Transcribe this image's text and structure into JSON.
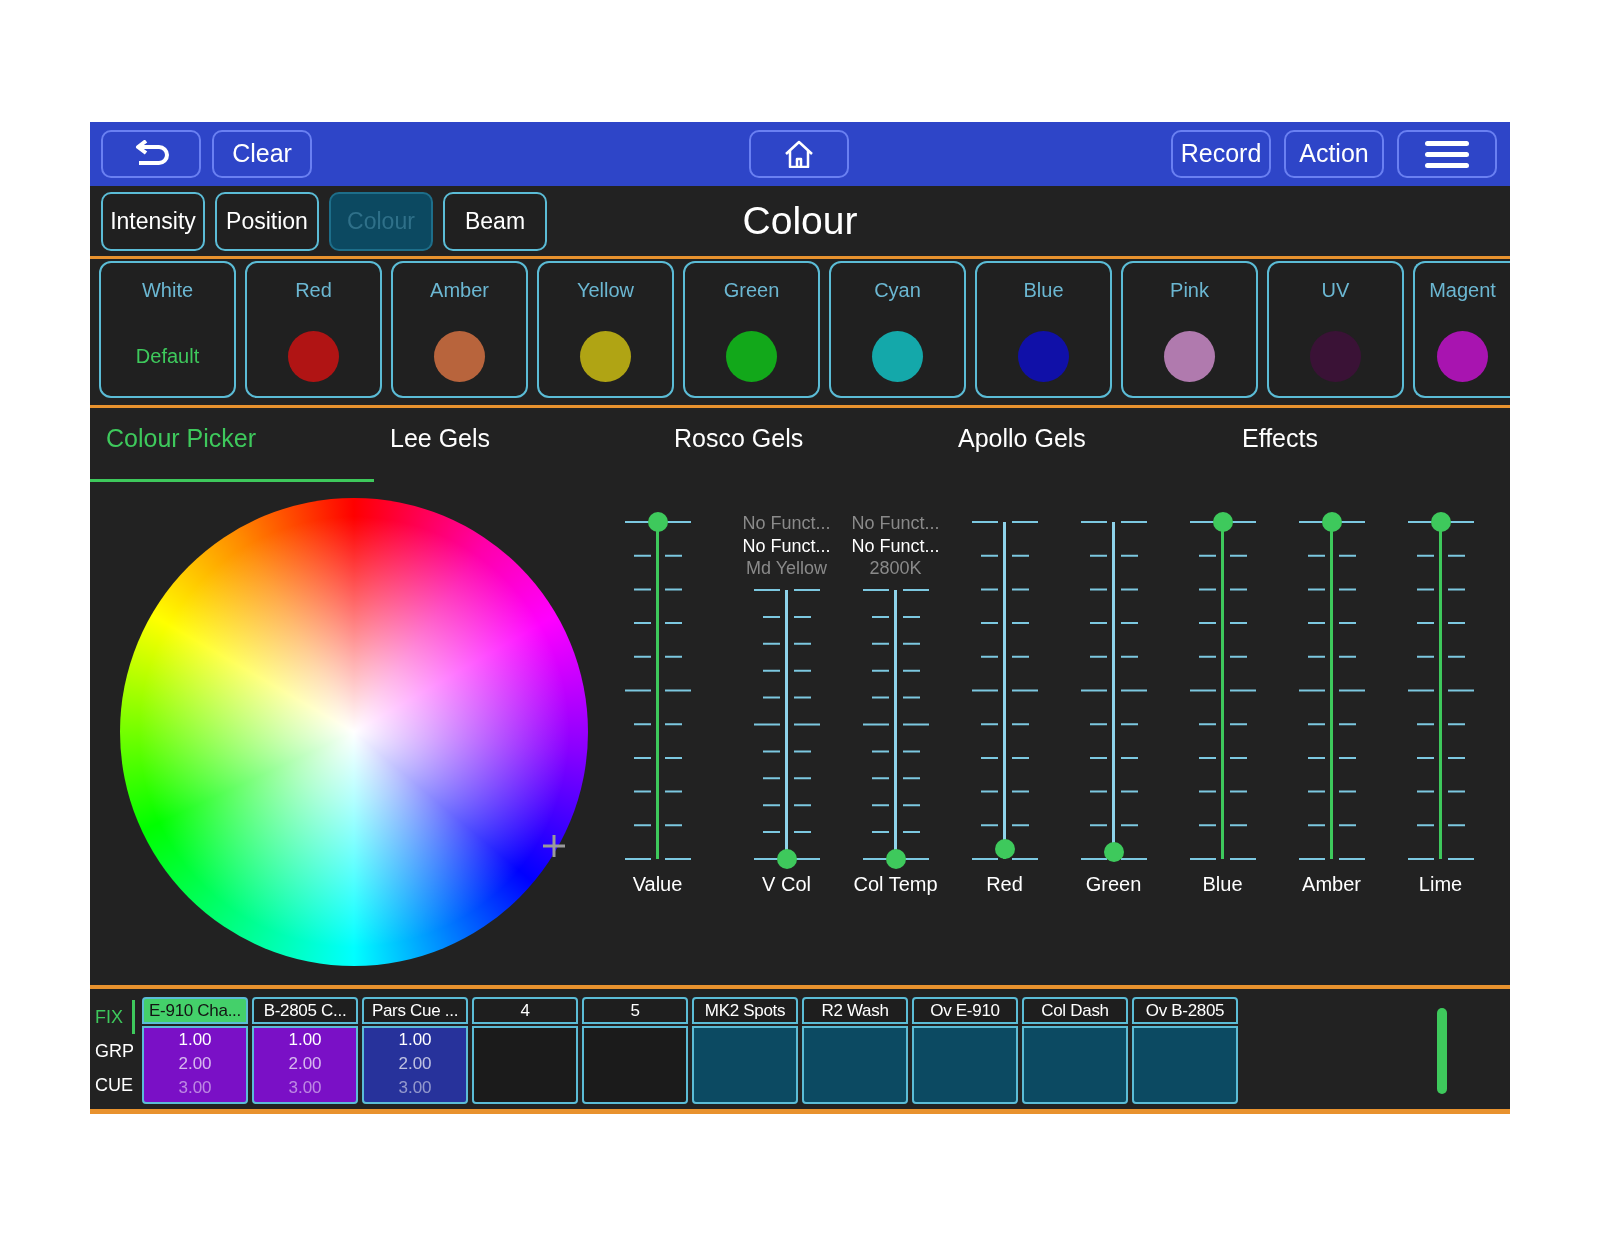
{
  "toolbar": {
    "left": [
      {
        "kind": "back"
      },
      {
        "kind": "text",
        "label": "Clear"
      }
    ],
    "center": [
      {
        "kind": "home"
      }
    ],
    "right": [
      {
        "kind": "text",
        "label": "Record"
      },
      {
        "kind": "text",
        "label": "Action"
      },
      {
        "kind": "menu"
      }
    ]
  },
  "attribute_tabs": [
    {
      "label": "Intensity",
      "selected": false
    },
    {
      "label": "Position",
      "selected": false
    },
    {
      "label": "Colour",
      "selected": true
    },
    {
      "label": "Beam",
      "selected": false
    }
  ],
  "title": "Colour",
  "swatches": [
    {
      "label": "White",
      "kind": "text",
      "text": "Default"
    },
    {
      "label": "Red",
      "kind": "dot",
      "color": "#b01414"
    },
    {
      "label": "Amber",
      "kind": "dot",
      "color": "#b8643c"
    },
    {
      "label": "Yellow",
      "kind": "dot",
      "color": "#b0a414"
    },
    {
      "label": "Green",
      "kind": "dot",
      "color": "#12a81a"
    },
    {
      "label": "Cyan",
      "kind": "dot",
      "color": "#14a8aa"
    },
    {
      "label": "Blue",
      "kind": "dot",
      "color": "#1010a8"
    },
    {
      "label": "Pink",
      "kind": "dot",
      "color": "#b07aae"
    },
    {
      "label": "UV",
      "kind": "dot",
      "color": "#3a1236"
    },
    {
      "label": "Magent",
      "kind": "dot",
      "color": "#a814b0"
    }
  ],
  "sub_tabs": [
    {
      "label": "Colour Picker",
      "selected": true
    },
    {
      "label": "Lee Gels",
      "selected": false
    },
    {
      "label": "Rosco Gels",
      "selected": false
    },
    {
      "label": "Apollo Gels",
      "selected": false
    },
    {
      "label": "Effects",
      "selected": false
    }
  ],
  "faders": [
    {
      "label": "Value",
      "level": 1
    },
    {
      "label": "V Col",
      "level": 0,
      "info": [
        {
          "text": "No Funct...",
          "selected": false
        },
        {
          "text": "No Funct...",
          "selected": true
        },
        {
          "text": "Md Yellow",
          "selected": false
        }
      ]
    },
    {
      "label": "Col Temp",
      "level": 0,
      "info": [
        {
          "text": "No Funct...",
          "selected": false
        },
        {
          "text": "No Funct...",
          "selected": true
        },
        {
          "text": "2800K",
          "selected": false
        }
      ]
    },
    {
      "label": "Red",
      "level": 0.03
    },
    {
      "label": "Green",
      "level": 0.02
    },
    {
      "label": "Blue",
      "level": 1
    },
    {
      "label": "Amber",
      "level": 1
    },
    {
      "label": "Lime",
      "level": 1
    }
  ],
  "playbacks": {
    "rows": [
      {
        "label": "FIX",
        "selected": true
      },
      {
        "label": "GRP",
        "selected": false
      },
      {
        "label": "CUE",
        "selected": false
      }
    ],
    "cells": [
      {
        "label": "E-910 Cha...",
        "selected": true,
        "color": "#7a10c6",
        "values": [
          "1.00",
          "2.00",
          "3.00"
        ]
      },
      {
        "label": "B-2805 C...",
        "selected": false,
        "color": "#7a10c6",
        "values": [
          "1.00",
          "2.00",
          "3.00"
        ]
      },
      {
        "label": "Pars Cue ...",
        "selected": false,
        "color": "#27329b",
        "values": [
          "1.00",
          "2.00",
          "3.00"
        ]
      },
      {
        "label": "4",
        "selected": false,
        "color": "#1b1b1b"
      },
      {
        "label": "5",
        "selected": false,
        "color": "#1b1b1b"
      },
      {
        "label": "MK2 Spots",
        "selected": false,
        "color": "#0c4a62"
      },
      {
        "label": "R2 Wash",
        "selected": false,
        "color": "#0c4a62"
      },
      {
        "label": "Ov E-910",
        "selected": false,
        "color": "#0c4a62"
      },
      {
        "label": "Col Dash",
        "selected": false,
        "color": "#0c4a62"
      },
      {
        "label": "Ov B-2805",
        "selected": false,
        "color": "#0c4a62"
      }
    ]
  }
}
